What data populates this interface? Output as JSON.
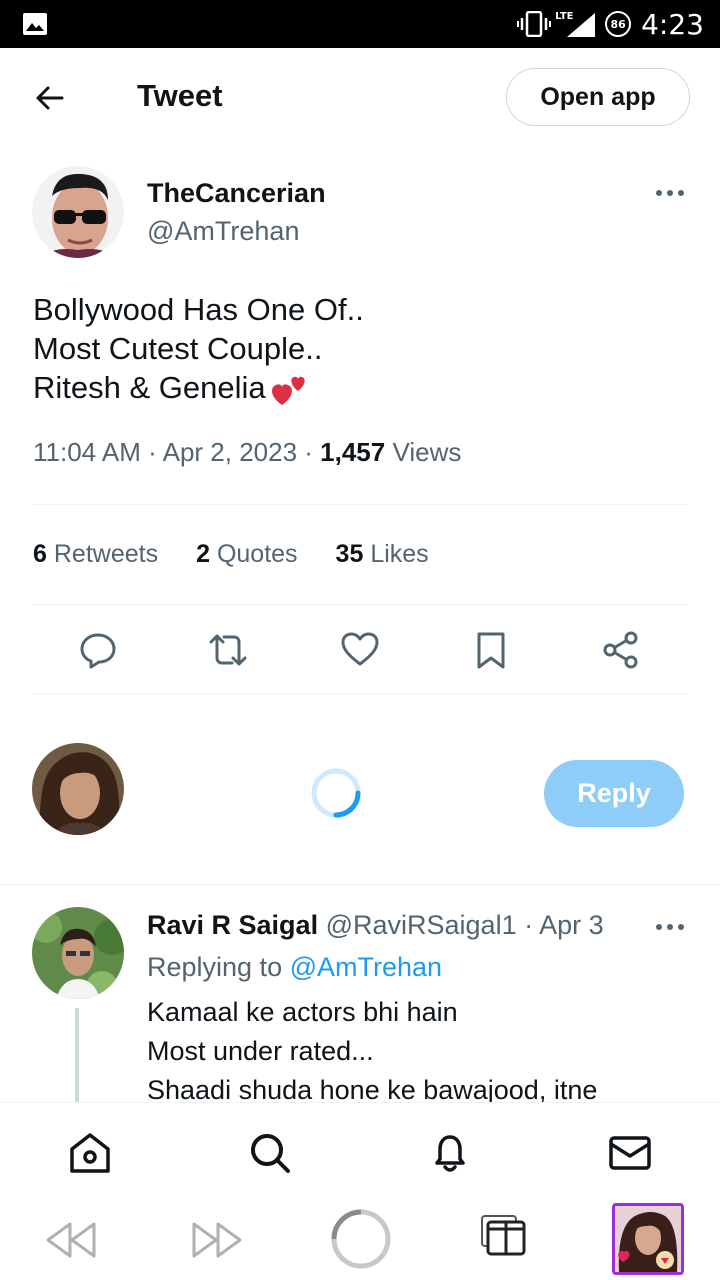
{
  "status_bar": {
    "time": "4:23",
    "battery": "86",
    "network": "LTE",
    "icons": [
      "image-icon",
      "vibrate-icon",
      "signal-icon",
      "battery-icon"
    ]
  },
  "header": {
    "title": "Tweet",
    "open_app_label": "Open app"
  },
  "tweet": {
    "display_name": "TheCancerian",
    "handle": "@AmTrehan",
    "text_lines": [
      "Bollywood Has One Of..",
      "Most Cutest Couple..",
      "Ritesh & Genelia"
    ],
    "emoji": "two-hearts",
    "time": "11:04 AM",
    "date": "Apr 2, 2023",
    "views_count": "1,457",
    "views_label": "Views",
    "retweets_count": "6",
    "retweets_label": "Retweets",
    "quotes_count": "2",
    "quotes_label": "Quotes",
    "likes_count": "35",
    "likes_label": "Likes"
  },
  "composer": {
    "reply_label": "Reply"
  },
  "reply": {
    "display_name": "Ravi R Saigal",
    "handle": "@RaviRSaigal1",
    "date": "Apr 3",
    "replying_prefix": "Replying to",
    "replying_to": "@AmTrehan",
    "text_lines": [
      "Kamaal ke actors bhi hain",
      "Most under rated...",
      "Shaadi shuda hone ke bawajood, itne"
    ]
  },
  "colors": {
    "accent": "#1d9bf0",
    "reply_button": "#8ecdf7",
    "secondary_text": "#536471",
    "primary_text": "#0f1419"
  }
}
